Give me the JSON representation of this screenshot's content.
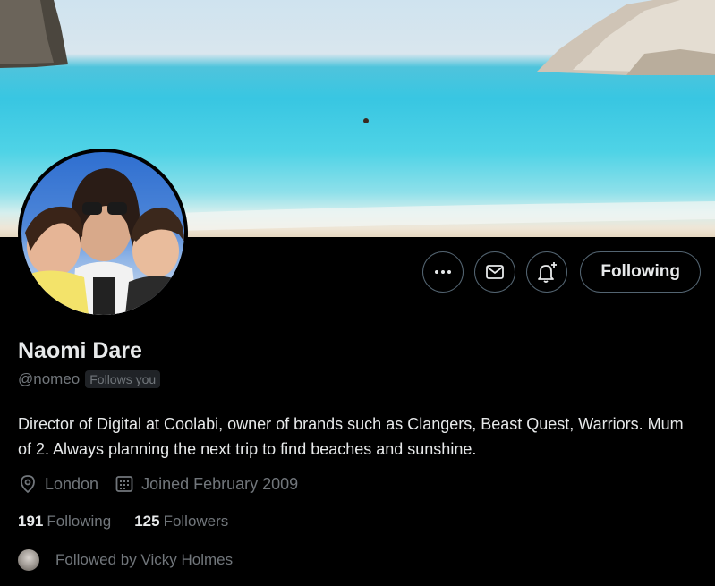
{
  "profile": {
    "name": "Naomi Dare",
    "handle": "@nomeo",
    "follows_you_badge": "Follows you",
    "bio": "Director of Digital at Coolabi, owner of brands such as Clangers, Beast Quest, Warriors. Mum of 2. Always planning the next trip to find beaches and sunshine.",
    "location": "London",
    "joined": "Joined February 2009",
    "following_count": "191",
    "following_label": "Following",
    "followers_count": "125",
    "followers_label": "Followers",
    "followed_by": "Followed by Vicky Holmes"
  },
  "actions": {
    "more_icon": "more-icon",
    "message_icon": "envelope-icon",
    "notify_icon": "bell-plus-icon",
    "following_button": "Following"
  },
  "colors": {
    "background": "#000000",
    "text_primary": "#e7e9ea",
    "text_secondary": "#71767b",
    "border": "#536471"
  }
}
